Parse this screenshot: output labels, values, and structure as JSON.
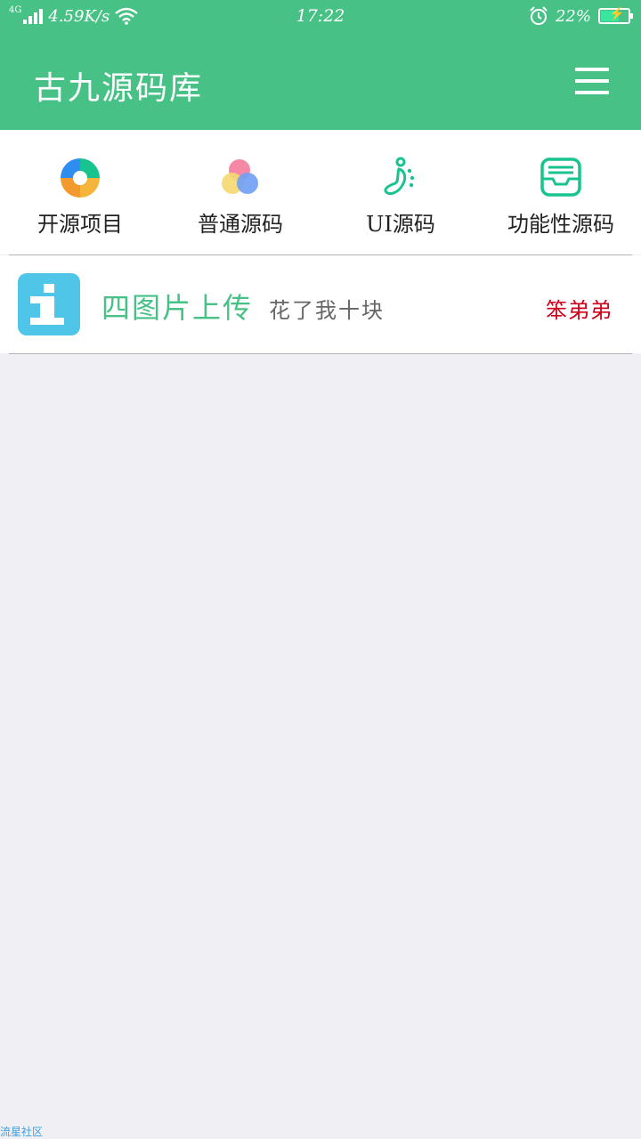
{
  "status_bar": {
    "network_type": "4G",
    "speed": "4.59K/s",
    "time": "17:22",
    "battery_percent": "22%"
  },
  "app_bar": {
    "title": "古九源码库",
    "menu_icon": "hamburger-menu-icon"
  },
  "categories": [
    {
      "label": "开源项目",
      "icon": "aperture-icon"
    },
    {
      "label": "普通源码",
      "icon": "color-circles-icon"
    },
    {
      "label": "UI源码",
      "icon": "footprint-icon"
    },
    {
      "label": "功能性源码",
      "icon": "inbox-icon"
    }
  ],
  "list": [
    {
      "title": "四图片上传",
      "description": "花了我十块",
      "author": "笨弟弟",
      "icon": "info-icon"
    }
  ],
  "watermark": "流星社区",
  "colors": {
    "primary": "#48c187",
    "background": "#efeff4",
    "author": "#d0021b",
    "icon_blue": "#4fc6e8"
  }
}
